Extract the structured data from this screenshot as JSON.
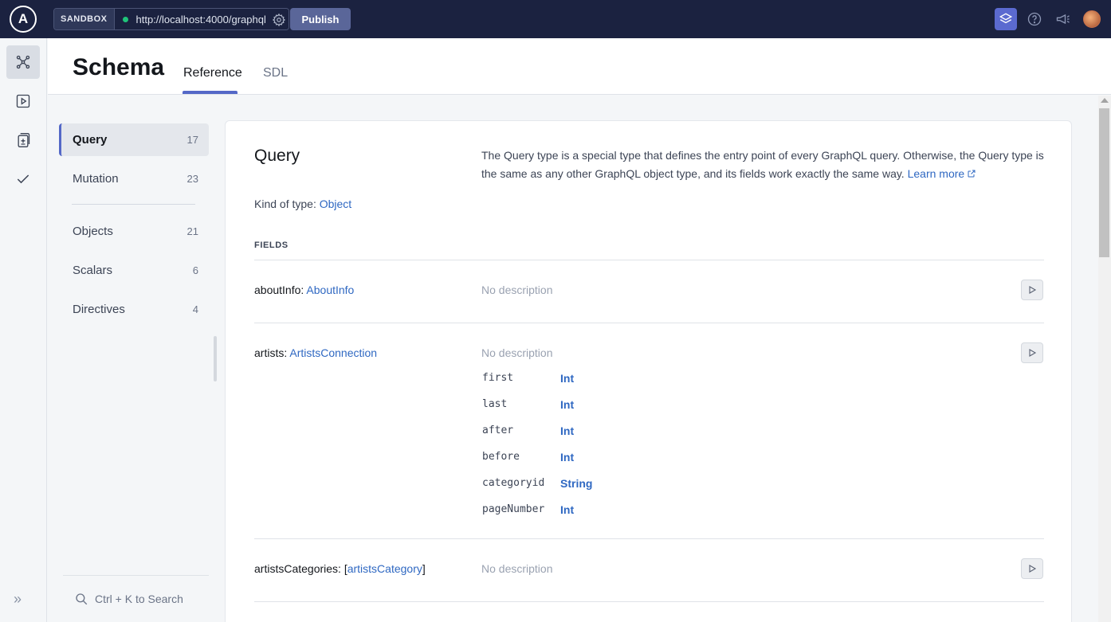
{
  "topbar": {
    "logo_letter": "A",
    "sandbox_label": "SANDBOX",
    "endpoint_url": "http://localhost:4000/graphql",
    "publish_label": "Publish",
    "icons": [
      "schema-reference-icon",
      "help-icon",
      "megaphone-icon",
      "user-avatar"
    ]
  },
  "rail": {
    "items": [
      "schema-icon",
      "explorer-play-icon",
      "changelog-icon",
      "checks-icon"
    ],
    "expand_icon": "»"
  },
  "header": {
    "title": "Schema",
    "tabs": [
      {
        "label": "Reference",
        "active": true
      },
      {
        "label": "SDL",
        "active": false
      }
    ]
  },
  "nav": {
    "items": [
      {
        "label": "Query",
        "count": "17",
        "active": true
      },
      {
        "label": "Mutation",
        "count": "23"
      },
      {
        "label": "Objects",
        "count": "21"
      },
      {
        "label": "Scalars",
        "count": "6"
      },
      {
        "label": "Directives",
        "count": "4"
      }
    ],
    "search_hint": "Ctrl + K to Search"
  },
  "content": {
    "type_name": "Query",
    "description": "The Query type is a special type that defines the entry point of every GraphQL query. Otherwise, the Query type is the same as any other GraphQL object type, and its fields work exactly the same way.",
    "learn_more": "Learn more",
    "kind_label": "Kind of type:",
    "kind_value": "Object",
    "fields_header": "FIELDS",
    "fields": [
      {
        "name": "aboutInfo:",
        "type": "AboutInfo",
        "type_prefix": "",
        "type_suffix": "",
        "description": "No description"
      },
      {
        "name": "artists:",
        "type": "ArtistsConnection",
        "type_prefix": "",
        "type_suffix": "",
        "description": "No description",
        "args": [
          {
            "name": "first",
            "type": "Int"
          },
          {
            "name": "last",
            "type": "Int"
          },
          {
            "name": "after",
            "type": "Int"
          },
          {
            "name": "before",
            "type": "Int"
          },
          {
            "name": "categoryid",
            "type": "String"
          },
          {
            "name": "pageNumber",
            "type": "Int"
          }
        ]
      },
      {
        "name": "artistsCategories:",
        "type": "artistsCategory",
        "type_prefix": "[",
        "type_suffix": "]",
        "description": "No description"
      }
    ]
  },
  "colors": {
    "topbar_bg": "#1b2240",
    "accent": "#5468c7",
    "link": "#2f68c2",
    "publish_bg": "#5a6699",
    "status_online": "#1fc47a"
  }
}
